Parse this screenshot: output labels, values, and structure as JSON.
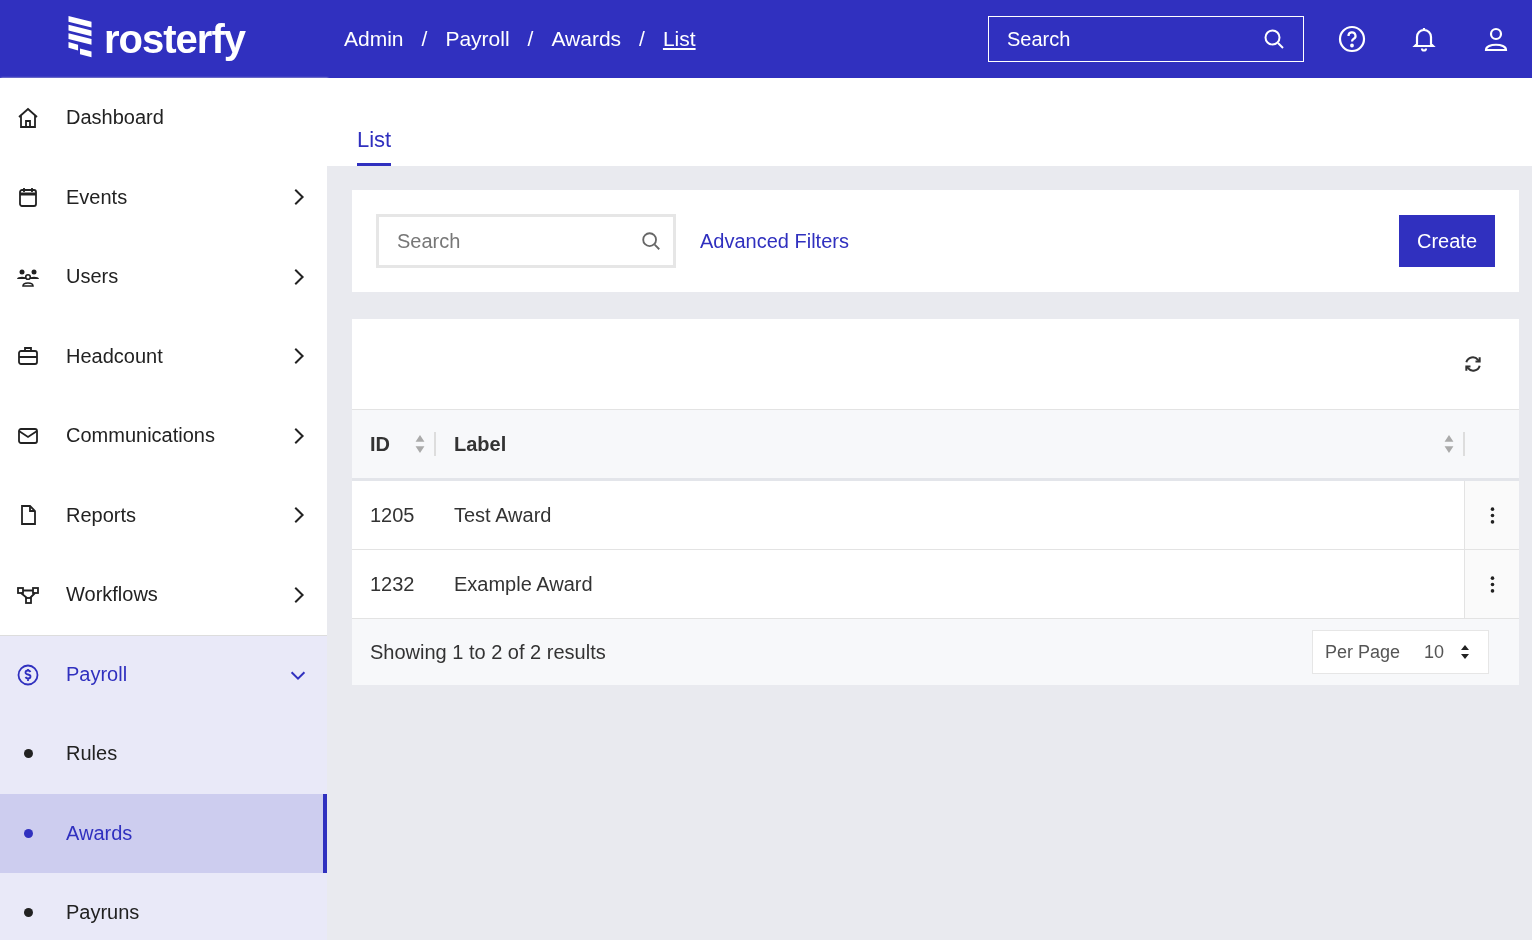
{
  "header": {
    "logo": "rosterfy",
    "breadcrumbs": [
      {
        "label": "Admin",
        "current": false
      },
      {
        "label": "Payroll",
        "current": false
      },
      {
        "label": "Awards",
        "current": false
      },
      {
        "label": "List",
        "current": true
      }
    ],
    "separator": "/",
    "search": {
      "placeholder": "Search"
    }
  },
  "sidebar": {
    "items": [
      {
        "label": "Dashboard",
        "has_children": false,
        "expanded": false,
        "selected": false
      },
      {
        "label": "Events",
        "has_children": true,
        "expanded": false,
        "selected": false
      },
      {
        "label": "Users",
        "has_children": true,
        "expanded": false,
        "selected": false
      },
      {
        "label": "Headcount",
        "has_children": true,
        "expanded": false,
        "selected": false
      },
      {
        "label": "Communications",
        "has_children": true,
        "expanded": false,
        "selected": false
      },
      {
        "label": "Reports",
        "has_children": true,
        "expanded": false,
        "selected": false
      },
      {
        "label": "Workflows",
        "has_children": true,
        "expanded": false,
        "selected": false
      },
      {
        "label": "Payroll",
        "has_children": true,
        "expanded": true,
        "selected": false,
        "children": [
          {
            "label": "Rules",
            "selected": false
          },
          {
            "label": "Awards",
            "selected": true
          },
          {
            "label": "Payruns",
            "selected": false
          }
        ]
      }
    ]
  },
  "tabs": [
    {
      "label": "List",
      "selected": true
    }
  ],
  "filters": {
    "search": {
      "placeholder": "Search"
    },
    "advanced_filters": "Advanced Filters",
    "create_button": "Create"
  },
  "table": {
    "columns": [
      "ID",
      "Label"
    ],
    "rows": [
      [
        "1205",
        "Test Award"
      ],
      [
        "1232",
        "Example Award"
      ]
    ],
    "summary": "Showing 1 to 2 of 2 results",
    "per_page": {
      "label": "Per Page",
      "value": "10"
    }
  }
}
